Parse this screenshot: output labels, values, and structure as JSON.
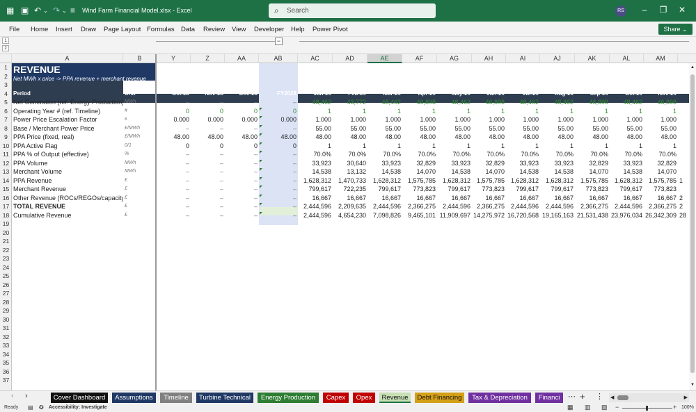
{
  "titlebar": {
    "title": "Wind Farm Financial Model.xlsx  -  Excel",
    "search_placeholder": "Search",
    "avatar": "RS",
    "autosave_icon": "save-icon",
    "undo": "↶",
    "redo": "↷"
  },
  "ribbon": {
    "menus": [
      "File",
      "Home",
      "Insert",
      "Draw",
      "Page Layout",
      "Formulas",
      "Data",
      "Review",
      "View",
      "Developer",
      "Help",
      "Power Pivot"
    ],
    "share": "Share"
  },
  "columns": [
    "A",
    "B",
    "Y",
    "Z",
    "AA",
    "AB",
    "AC",
    "AD",
    "AE",
    "AF",
    "AG",
    "AH",
    "AI",
    "AJ",
    "AK",
    "AL",
    "AM"
  ],
  "selected_column": "AE",
  "sheet": {
    "title": "REVENUE",
    "subtitle": "Net MWh x price -> PPA revenue + merchant revenue",
    "header_row": [
      "Period",
      "Unit",
      "Oct-28",
      "Nov-28",
      "Dec-28",
      "FY2028",
      "Jan-29",
      "Feb-29",
      "Mar-29",
      "Apr-29",
      "May-29",
      "Jun-29",
      "Jul-29",
      "Aug-29",
      "Sep-29",
      "Oct-29",
      "Nov-29"
    ],
    "rows": [
      {
        "r": 5,
        "label": "Net Generation (ref. Energy Production)",
        "unit": "MWh",
        "green": true,
        "vals": [
          "–",
          "–",
          "–",
          "–",
          "48,462",
          "43,772",
          "48,462",
          "46,898",
          "48,462",
          "46,898",
          "48,462",
          "48,462",
          "46,898",
          "48,462",
          "46,898"
        ]
      },
      {
        "r": 6,
        "label": "Operating Year # (ref. Timeline)",
        "unit": "#",
        "green": true,
        "vals": [
          "0",
          "0",
          "0",
          "0",
          "1",
          "1",
          "1",
          "1",
          "1",
          "1",
          "1",
          "1",
          "1",
          "1",
          "1"
        ]
      },
      {
        "r": 7,
        "label": "Power Price Escalation Factor",
        "unit": "x",
        "vals": [
          "0.000",
          "0.000",
          "0.000",
          "0.000",
          "1.000",
          "1.000",
          "1.000",
          "1.000",
          "1.000",
          "1.000",
          "1.000",
          "1.000",
          "1.000",
          "1.000",
          "1.000"
        ]
      },
      {
        "r": 8,
        "label": "Base / Merchant Power Price",
        "unit": "£/MWh",
        "vals": [
          "–",
          "–",
          "–",
          "–",
          "55.00",
          "55.00",
          "55.00",
          "55.00",
          "55.00",
          "55.00",
          "55.00",
          "55.00",
          "55.00",
          "55.00",
          "55.00"
        ]
      },
      {
        "r": 9,
        "label": "PPA Price (fixed, real)",
        "unit": "£/MWh",
        "vals": [
          "48.00",
          "48.00",
          "48.00",
          "48.00",
          "48.00",
          "48.00",
          "48.00",
          "48.00",
          "48.00",
          "48.00",
          "48.00",
          "48.00",
          "48.00",
          "48.00",
          "48.00"
        ]
      },
      {
        "r": 10,
        "label": "PPA Active Flag",
        "unit": "0/1",
        "vals": [
          "0",
          "0",
          "0",
          "0",
          "1",
          "1",
          "1",
          "1",
          "1",
          "1",
          "1",
          "1",
          "1",
          "1",
          "1"
        ]
      },
      {
        "r": 11,
        "label": "PPA % of Output (effective)",
        "unit": "%",
        "vals": [
          "–",
          "–",
          "–",
          "–",
          "70.0%",
          "70.0%",
          "70.0%",
          "70.0%",
          "70.0%",
          "70.0%",
          "70.0%",
          "70.0%",
          "70.0%",
          "70.0%",
          "70.0%"
        ]
      },
      {
        "r": 12,
        "label": "PPA Volume",
        "unit": "MWh",
        "vals": [
          "–",
          "–",
          "–",
          "–",
          "33,923",
          "30,640",
          "33,923",
          "32,829",
          "33,923",
          "32,829",
          "33,923",
          "33,923",
          "32,829",
          "33,923",
          "32,829"
        ]
      },
      {
        "r": 13,
        "label": "Merchant Volume",
        "unit": "MWh",
        "vals": [
          "–",
          "–",
          "–",
          "–",
          "14,538",
          "13,132",
          "14,538",
          "14,070",
          "14,538",
          "14,070",
          "14,538",
          "14,538",
          "14,070",
          "14,538",
          "14,070"
        ]
      },
      {
        "r": 14,
        "label": "PPA Revenue",
        "unit": "£",
        "vals": [
          "–",
          "–",
          "–",
          "–",
          "1,628,312",
          "1,470,733",
          "1,628,312",
          "1,575,785",
          "1,628,312",
          "1,575,785",
          "1,628,312",
          "1,628,312",
          "1,575,785",
          "1,628,312",
          "1,575,785"
        ]
      },
      {
        "r": 15,
        "label": "Merchant Revenue",
        "unit": "£",
        "vals": [
          "–",
          "–",
          "–",
          "–",
          "799,617",
          "722,235",
          "799,617",
          "773,823",
          "799,617",
          "773,823",
          "799,617",
          "799,617",
          "773,823",
          "799,617",
          "773,823"
        ]
      },
      {
        "r": 16,
        "label": "Other Revenue (ROCs/REGOs/capacity)",
        "unit": "£",
        "vals": [
          "–",
          "–",
          "–",
          "–",
          "16,667",
          "16,667",
          "16,667",
          "16,667",
          "16,667",
          "16,667",
          "16,667",
          "16,667",
          "16,667",
          "16,667",
          "16,667"
        ]
      },
      {
        "r": 17,
        "label": "TOTAL REVENUE",
        "unit": "£",
        "bold": true,
        "vals": [
          "–",
          "–",
          "–",
          "–",
          "2,444,596",
          "2,209,635",
          "2,444,596",
          "2,366,275",
          "2,444,596",
          "2,366,275",
          "2,444,596",
          "2,444,596",
          "2,366,275",
          "2,444,596",
          "2,366,275"
        ]
      },
      {
        "r": 18,
        "label": "Cumulative Revenue",
        "unit": "£",
        "vals": [
          "–",
          "–",
          "–",
          "–",
          "2,444,596",
          "4,654,230",
          "7,098,826",
          "9,465,101",
          "11,909,697",
          "14,275,972",
          "16,720,568",
          "19,165,163",
          "21,531,438",
          "23,976,034",
          "26,342,309"
        ]
      }
    ],
    "edge_values": {
      "14": "1",
      "16": "2",
      "17": "2",
      "18": "28"
    }
  },
  "tabs": [
    {
      "label": "Cover Dashboard",
      "color": "#111111"
    },
    {
      "label": "Assumptions",
      "color": "#1f3864"
    },
    {
      "label": "Timeline",
      "color": "#808080"
    },
    {
      "label": "Turbine Technical",
      "color": "#1f3864"
    },
    {
      "label": "Energy Production",
      "color": "#2e7d32"
    },
    {
      "label": "Capex",
      "color": "#c00000"
    },
    {
      "label": "Opex",
      "color": "#c00000"
    },
    {
      "label": "Revenue",
      "color": "#c6e0b4",
      "active": true
    },
    {
      "label": "Debt Financing",
      "color": "#d4a017"
    },
    {
      "label": "Tax & Depreciation",
      "color": "#7030a0"
    },
    {
      "label": "Financi",
      "color": "#7030a0"
    }
  ],
  "status": {
    "ready": "Ready",
    "accessibility": "Accessibility: Investigate",
    "zoom": "100%"
  },
  "colors": {
    "brand": "#1e7145",
    "header_navy": "#2f3d51",
    "title_navy": "#1f3864",
    "fy_column": "#dce3f5",
    "input_green": "#2e8b2e"
  }
}
